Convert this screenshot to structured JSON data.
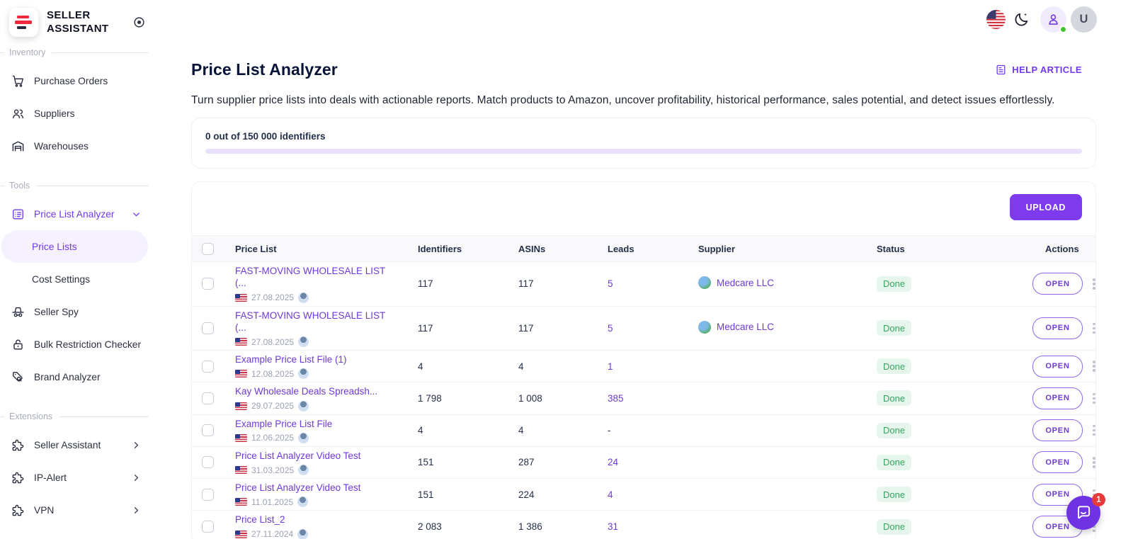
{
  "brand": {
    "line1": "SELLER",
    "line2": "ASSISTANT"
  },
  "topbar": {
    "avatar_letter": "U"
  },
  "sidebar": {
    "sections": [
      {
        "label": "Inventory",
        "items": [
          {
            "label": "Purchase Orders",
            "icon": "cart"
          },
          {
            "label": "Suppliers",
            "icon": "people"
          },
          {
            "label": "Warehouses",
            "icon": "warehouse"
          }
        ]
      },
      {
        "label": "Tools",
        "items": [
          {
            "label": "Price List Analyzer",
            "icon": "list",
            "active": true,
            "chevron": "down"
          },
          {
            "label": "Price Lists",
            "sub": true,
            "selected": true
          },
          {
            "label": "Cost Settings",
            "sub": true
          },
          {
            "label": "Seller Spy",
            "icon": "spy"
          },
          {
            "label": "Bulk Restriction Checker",
            "icon": "lock"
          },
          {
            "label": "Brand Analyzer",
            "icon": "tag-search"
          }
        ]
      },
      {
        "label": "Extensions",
        "items": [
          {
            "label": "Seller Assistant",
            "icon": "puzzle",
            "chevron": "right"
          },
          {
            "label": "IP-Alert",
            "icon": "puzzle",
            "chevron": "right"
          },
          {
            "label": "VPN",
            "icon": "puzzle",
            "chevron": "right"
          }
        ]
      }
    ]
  },
  "page": {
    "title": "Price List Analyzer",
    "help_link": "HELP ARTICLE",
    "description": "Turn supplier price lists into deals with actionable reports. Match products to Amazon, uncover profitability, historical performance, sales potential, and detect issues effortlessly.",
    "quota": {
      "text": "0 out of 150 000 identifiers",
      "progress_percent": 0
    }
  },
  "table": {
    "upload_label": "UPLOAD",
    "open_label": "OPEN",
    "columns": [
      "Price List",
      "Identifiers",
      "ASINs",
      "Leads",
      "Supplier",
      "Status",
      "Actions"
    ],
    "rows": [
      {
        "name": "FAST-MOVING WHOLESALE LIST (...",
        "date": "27.08.2025",
        "identifiers": "117",
        "asins": "117",
        "leads": "5",
        "supplier": "Medcare LLC",
        "status": "Done"
      },
      {
        "name": "FAST-MOVING WHOLESALE LIST (...",
        "date": "27.08.2025",
        "identifiers": "117",
        "asins": "117",
        "leads": "5",
        "supplier": "Medcare LLC",
        "status": "Done"
      },
      {
        "name": "Example Price List File (1)",
        "date": "12.08.2025",
        "identifiers": "4",
        "asins": "4",
        "leads": "1",
        "supplier": "",
        "status": "Done"
      },
      {
        "name": "Kay Wholesale Deals Spreadsh...",
        "date": "29.07.2025",
        "identifiers": "1 798",
        "asins": "1 008",
        "leads": "385",
        "supplier": "",
        "status": "Done"
      },
      {
        "name": "Example Price List File",
        "date": "12.06.2025",
        "identifiers": "4",
        "asins": "4",
        "leads": "-",
        "supplier": "",
        "status": "Done"
      },
      {
        "name": "Price List Analyzer Video Test",
        "date": "31.03.2025",
        "identifiers": "151",
        "asins": "287",
        "leads": "24",
        "supplier": "",
        "status": "Done"
      },
      {
        "name": "Price List Analyzer Video Test",
        "date": "11.01.2025",
        "identifiers": "151",
        "asins": "224",
        "leads": "4",
        "supplier": "",
        "status": "Done"
      },
      {
        "name": "Price List_2",
        "date": "27.11.2024",
        "identifiers": "2 083",
        "asins": "1 386",
        "leads": "31",
        "supplier": "",
        "status": "Done"
      }
    ]
  },
  "chat": {
    "badge": "1"
  },
  "colors": {
    "accent": "#7239ea",
    "upload_button": "#7e3bee",
    "success_text": "#36a45f",
    "success_bg": "#e7f6ec",
    "logo_red": "#f0283c"
  }
}
